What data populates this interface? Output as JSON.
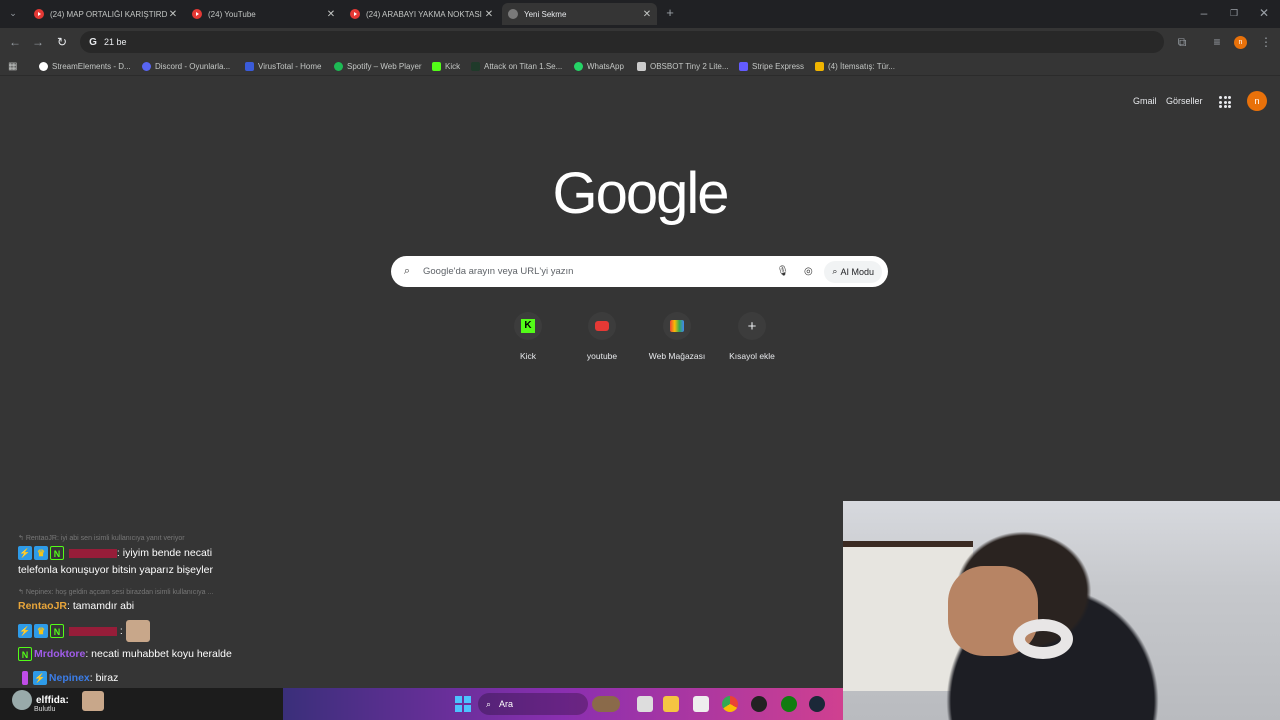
{
  "tabs": [
    {
      "title": "(24) MAP ORTALIĞI KARIŞTIRDI",
      "icon": "youtube-icon"
    },
    {
      "title": "(24) YouTube",
      "icon": "youtube-icon"
    },
    {
      "title": "(24) ARABAYI YAKMA NOKTASI",
      "icon": "youtube-icon"
    },
    {
      "title": "Yeni Sekme",
      "icon": "google-icon",
      "active": true
    }
  ],
  "address": {
    "value": "21 be"
  },
  "bookmarks": [
    {
      "label": "StreamElements - D...",
      "color": "#ffffff"
    },
    {
      "label": "Discord - Oyunlarla...",
      "color": "#5865f2"
    },
    {
      "label": "VirusTotal - Home",
      "color": "#3a5bd9"
    },
    {
      "label": "Spotify – Web Player",
      "color": "#1db954"
    },
    {
      "label": "Kick",
      "color": "#53fc18"
    },
    {
      "label": "Attack on Titan 1.Se...",
      "color": "#1f3a2a"
    },
    {
      "label": "WhatsApp",
      "color": "#25d366"
    },
    {
      "label": "OBSBOT Tiny 2 Lite...",
      "color": "#cccccc"
    },
    {
      "label": "Stripe Express",
      "color": "#635bff"
    },
    {
      "label": "(4) İtemsatış: Tür...",
      "color": "#f0b400"
    }
  ],
  "header": {
    "gmail": "Gmail",
    "images": "Görseller",
    "avatar_letter": "n"
  },
  "logo": "Google",
  "search": {
    "placeholder": "Google'da arayın veya URL'yi yazın",
    "ai_mode": "AI Modu"
  },
  "shortcuts": [
    {
      "label": "Kick",
      "icon": "kick-icon"
    },
    {
      "label": "youtube",
      "icon": "youtube-icon"
    },
    {
      "label": "Web Mağazası",
      "icon": "webstore-icon"
    },
    {
      "label": "Kısayol ekle",
      "icon": "plus-icon"
    }
  ],
  "chat": {
    "reply1": "RentaoJR: iyi abi sen isimli kullanıcıya yanıt veriyor",
    "msg1_text": ": iyiyim bende necati",
    "msg1_cont": "telefonla konuşuyor bitsin yaparız bişeyler",
    "reply2": "Nepinex: hoş geldin açcam sesi birazdan isimli kullanıcıya ...",
    "msg2_user": "RentaoJR",
    "msg2_text": ": tamamdır abi",
    "msg4_user": "Mrdoktore",
    "msg4_text": ": necati muhabbet koyu heralde",
    "msg5_user": "Nepinex",
    "msg5_text": ": biraz",
    "msg6_user": "elffida:",
    "user_colors": {
      "rentao": "#e8a53a",
      "mrdoktore": "#a05ce8",
      "nepinex": "#3b7de8",
      "redacted": "#c0143c"
    }
  },
  "taskbar": {
    "search": "Ara",
    "sub": "Bulutlu"
  }
}
